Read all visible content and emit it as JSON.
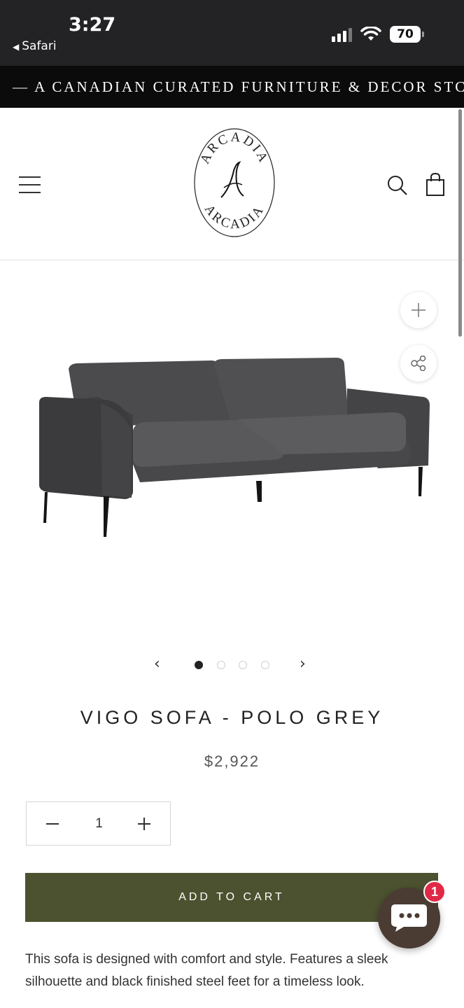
{
  "status_bar": {
    "time": "3:27",
    "back_app": "Safari",
    "battery": "70"
  },
  "announcement": {
    "text": "— A CANADIAN CURATED FURNITURE & DECOR STC"
  },
  "header": {
    "logo_text": "ARCADIA"
  },
  "gallery": {
    "slide_count": 4,
    "active_slide": 1,
    "prev_label": "‹",
    "next_label": "›"
  },
  "product": {
    "title": "VIGO SOFA - POLO GREY",
    "price": "$2,922",
    "quantity": "1",
    "add_to_cart_label": "ADD TO CART",
    "description": "This sofa is designed with comfort and style. Features a sleek silhouette and black finished steel feet for a timeless look."
  },
  "chat": {
    "badge_count": "1"
  },
  "colors": {
    "cart_button": "#4c522f",
    "announcement_bg": "#0b0b0b",
    "chat_bg": "#4a3b33",
    "badge": "#e02946"
  }
}
